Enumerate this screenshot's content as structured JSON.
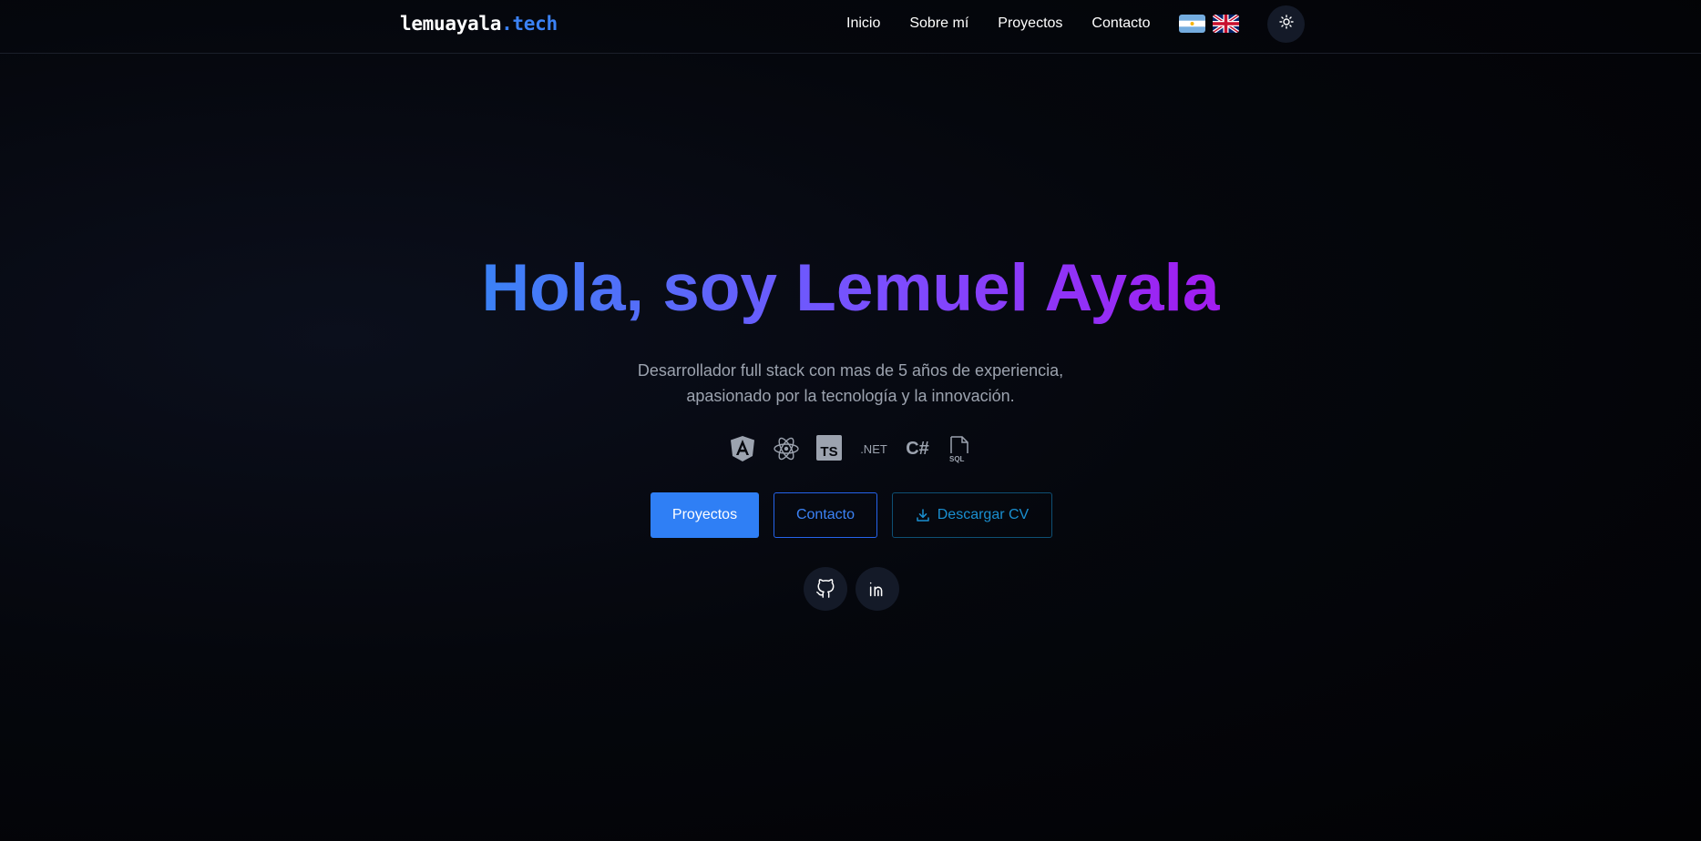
{
  "nav": {
    "logo_main": "lemuayala",
    "logo_suffix": ".tech",
    "links": [
      "Inicio",
      "Sobre mí",
      "Proyectos",
      "Contacto"
    ],
    "languages": [
      "flag-argentina-icon",
      "flag-uk-icon"
    ],
    "theme_toggle_icon": "sun-icon"
  },
  "hero": {
    "title": "Hola, soy Lemuel Ayala",
    "subtitle_line1": "Desarrollador full stack con mas de 5 años de experiencia,",
    "subtitle_line2": "apasionado por la tecnología y la innovación.",
    "tech_icons": [
      "angular-icon",
      "react-icon",
      "typescript-icon",
      "dotnet-icon",
      "csharp-icon",
      "sql-icon"
    ],
    "tech_labels": {
      "typescript": "TS",
      "dotnet": ".NET",
      "csharp": "C#",
      "sql": "SQL"
    },
    "buttons": {
      "projects": "Proyectos",
      "contact": "Contacto",
      "cv": "Descargar CV"
    },
    "social_icons": [
      "github-icon",
      "linkedin-icon"
    ]
  },
  "colors": {
    "accent": "#2f7ff5",
    "gradient_start": "#3b82f6",
    "gradient_end": "#a21cf0",
    "cv_accent": "#1a8fd0"
  }
}
